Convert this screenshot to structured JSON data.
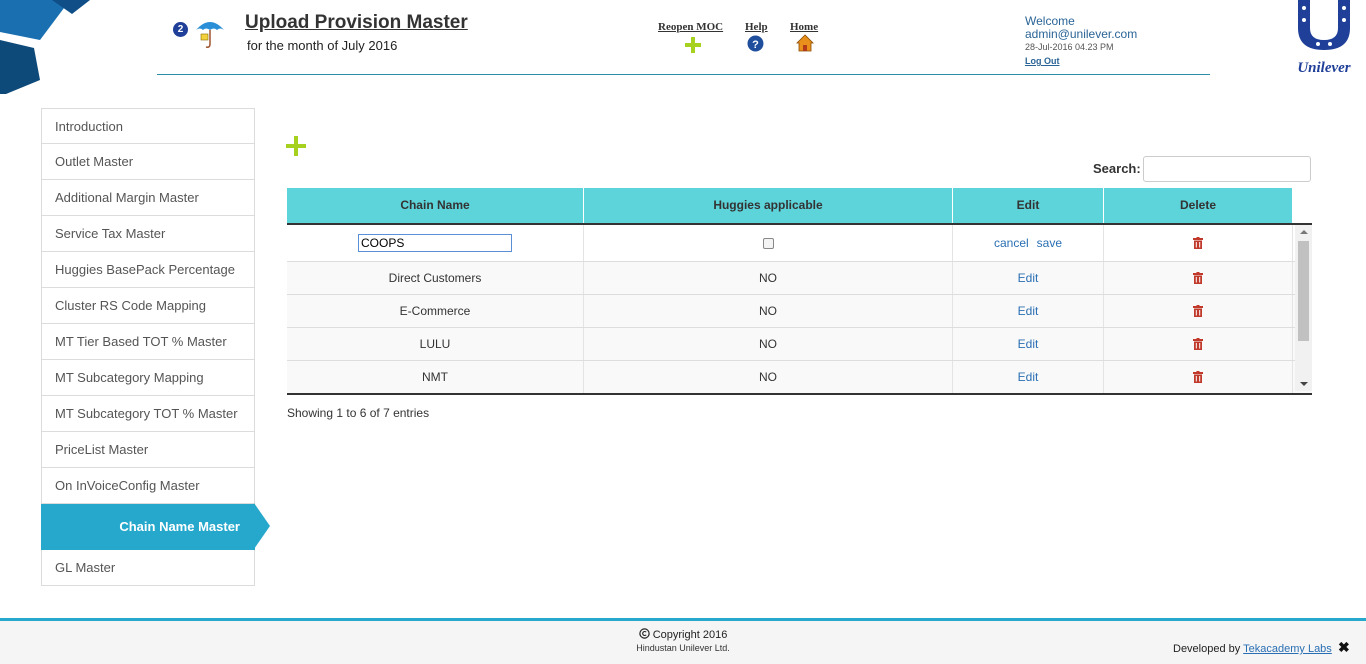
{
  "header": {
    "badge": "2",
    "title": "Upload Provision Master",
    "subtitle": "for the month of July 2016",
    "links": {
      "reopen": "Reopen MOC",
      "help": "Help",
      "home": "Home"
    },
    "welcome": "Welcome",
    "user_email": "admin@unilever.com",
    "datetime": "28-Jul-2016 04.23 PM",
    "logout": "Log Out",
    "logo_text": "Unilever"
  },
  "sidebar": {
    "items": [
      {
        "label": "Introduction",
        "active": false
      },
      {
        "label": "Outlet Master",
        "active": false
      },
      {
        "label": "Additional Margin Master",
        "active": false
      },
      {
        "label": "Service Tax Master",
        "active": false
      },
      {
        "label": "Huggies BasePack Percentage",
        "active": false
      },
      {
        "label": "Cluster RS Code Mapping",
        "active": false
      },
      {
        "label": "MT Tier Based TOT % Master",
        "active": false
      },
      {
        "label": "MT Subcategory Mapping",
        "active": false
      },
      {
        "label": "MT Subcategory TOT % Master",
        "active": false
      },
      {
        "label": "PriceList Master",
        "active": false
      },
      {
        "label": "On InVoiceConfig Master",
        "active": false
      },
      {
        "label": "Chain Name Master",
        "active": true
      },
      {
        "label": "GL Master",
        "active": false
      }
    ]
  },
  "search": {
    "label": "Search:",
    "value": ""
  },
  "table": {
    "columns": [
      "Chain Name",
      "Huggies applicable",
      "Edit",
      "Delete"
    ],
    "editing_row": {
      "chain_name": "COOPS",
      "huggies_checked": false,
      "cancel_label": "cancel",
      "save_label": "save"
    },
    "rows": [
      {
        "chain_name": "Direct Customers",
        "huggies": "NO",
        "edit": "Edit"
      },
      {
        "chain_name": "E-Commerce",
        "huggies": "NO",
        "edit": "Edit"
      },
      {
        "chain_name": "LULU",
        "huggies": "NO",
        "edit": "Edit"
      },
      {
        "chain_name": "NMT",
        "huggies": "NO",
        "edit": "Edit"
      }
    ]
  },
  "pagination": {
    "summary": "Showing 1 to 6 of 7 entries"
  },
  "footer": {
    "copyright": "Copyright 2016",
    "company": "Hindustan Unilever Ltd.",
    "developed_by_prefix": "Developed by",
    "developer": "Tekacademy Labs",
    "close_symbol": "✖"
  },
  "colors": {
    "accent": "#26a8cc",
    "table_header": "#5dd3da",
    "add_green": "#a6d11f",
    "trash_red": "#c0392b",
    "link_blue": "#2a6fb3"
  }
}
